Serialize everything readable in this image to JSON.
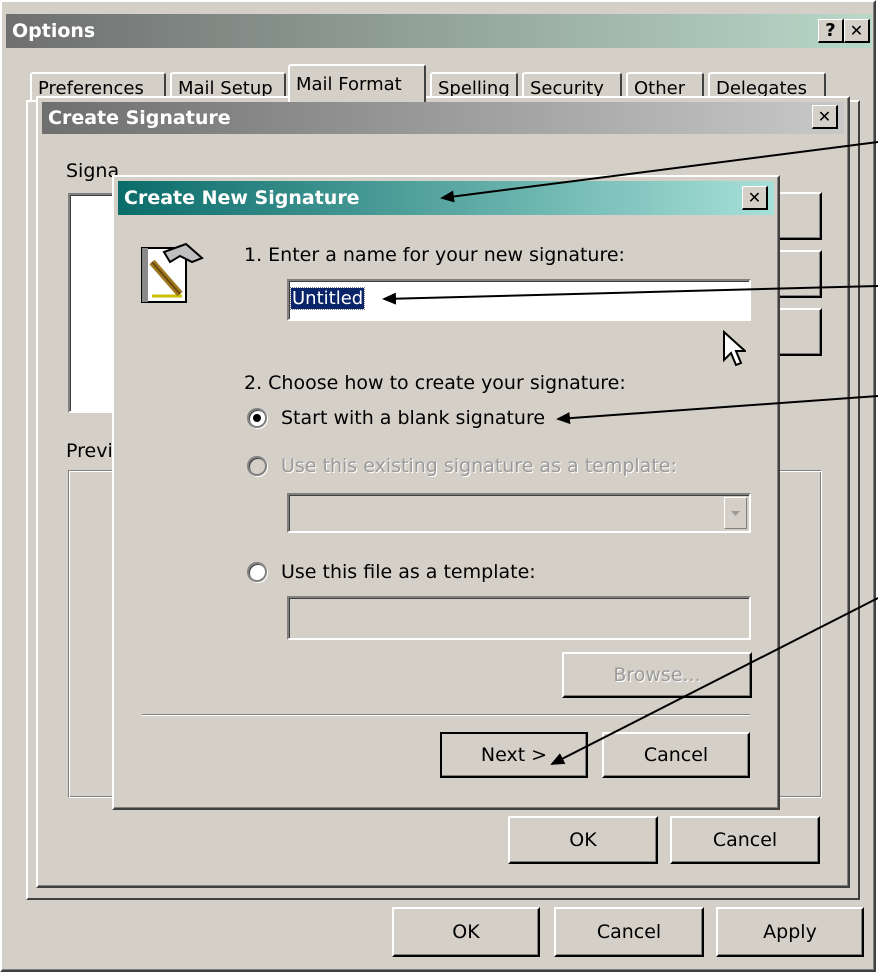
{
  "options": {
    "title": "Options",
    "help_label": "?",
    "close_label": "✕",
    "tabs": [
      "Preferences",
      "Mail Setup",
      "Mail Format",
      "Spelling",
      "Security",
      "Other",
      "Delegates"
    ],
    "ok_label": "OK",
    "cancel_label": "Cancel",
    "apply_label": "Apply"
  },
  "create_signature": {
    "title": "Create Signature",
    "close_label": "✕",
    "signature_label": "Signature:",
    "preview_label": "Preview:",
    "ok_label": "OK",
    "cancel_label": "Cancel"
  },
  "create_new_signature": {
    "title": "Create New Signature",
    "close_label": "✕",
    "icon": "hammer-paper-icon",
    "step1_label": "1. Enter a name for your new signature:",
    "name_value": "Untitled",
    "step2_label": "2. Choose how to create your signature:",
    "options": [
      {
        "label": "Start with a blank signature",
        "checked": true,
        "enabled": true
      },
      {
        "label": "Use this existing signature as a template:",
        "checked": false,
        "enabled": false
      },
      {
        "label": "Use this file as a template:",
        "checked": false,
        "enabled": true
      }
    ],
    "existing_signature_value": "",
    "file_value": "",
    "browse_label": "Browse...",
    "next_label": "Next >",
    "cancel_label": "Cancel"
  },
  "colors": {
    "titlebar_active_start": "#0a246a",
    "titlebar_active_end": "#a6caf0",
    "titlebar_teal_start": "#0a6c6a",
    "titlebar_teal_end": "#a6e0d8",
    "titlebar_inactive_start": "#6f6f6f",
    "titlebar_inactive_end": "#c0c0c0",
    "face": "#d4d0c8"
  }
}
